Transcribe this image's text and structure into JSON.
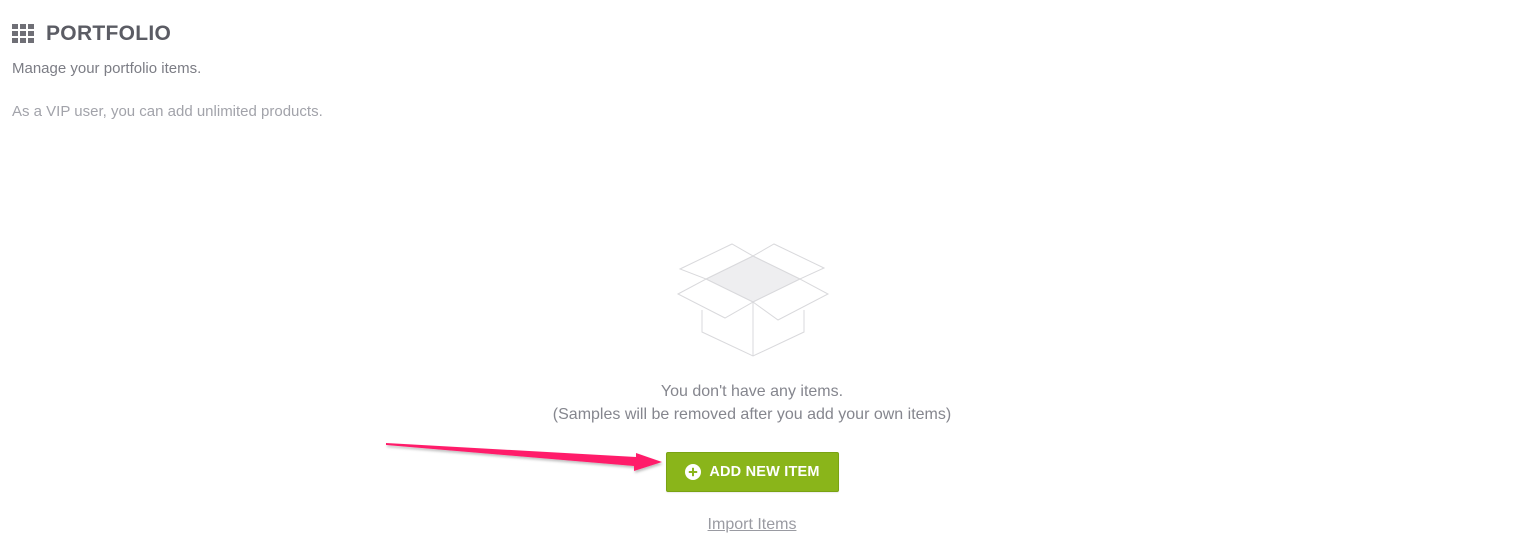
{
  "header": {
    "title": "PORTFOLIO",
    "icon": "grid-icon",
    "subtitle": "Manage your portfolio items.",
    "vip_note": "As a VIP user, you can add unlimited products."
  },
  "empty_state": {
    "icon": "empty-box-icon",
    "message": "You don't have any items.",
    "note": "(Samples will be removed after you add your own items)"
  },
  "actions": {
    "add_label": "ADD NEW ITEM",
    "add_icon": "plus-circle-icon",
    "import_label": "Import Items"
  },
  "annotation": {
    "type": "pointer-arrow",
    "color": "#ff1f6b"
  },
  "colors": {
    "accent": "#8ab51a",
    "title": "#5b5c64",
    "muted_text": "#85868e"
  }
}
